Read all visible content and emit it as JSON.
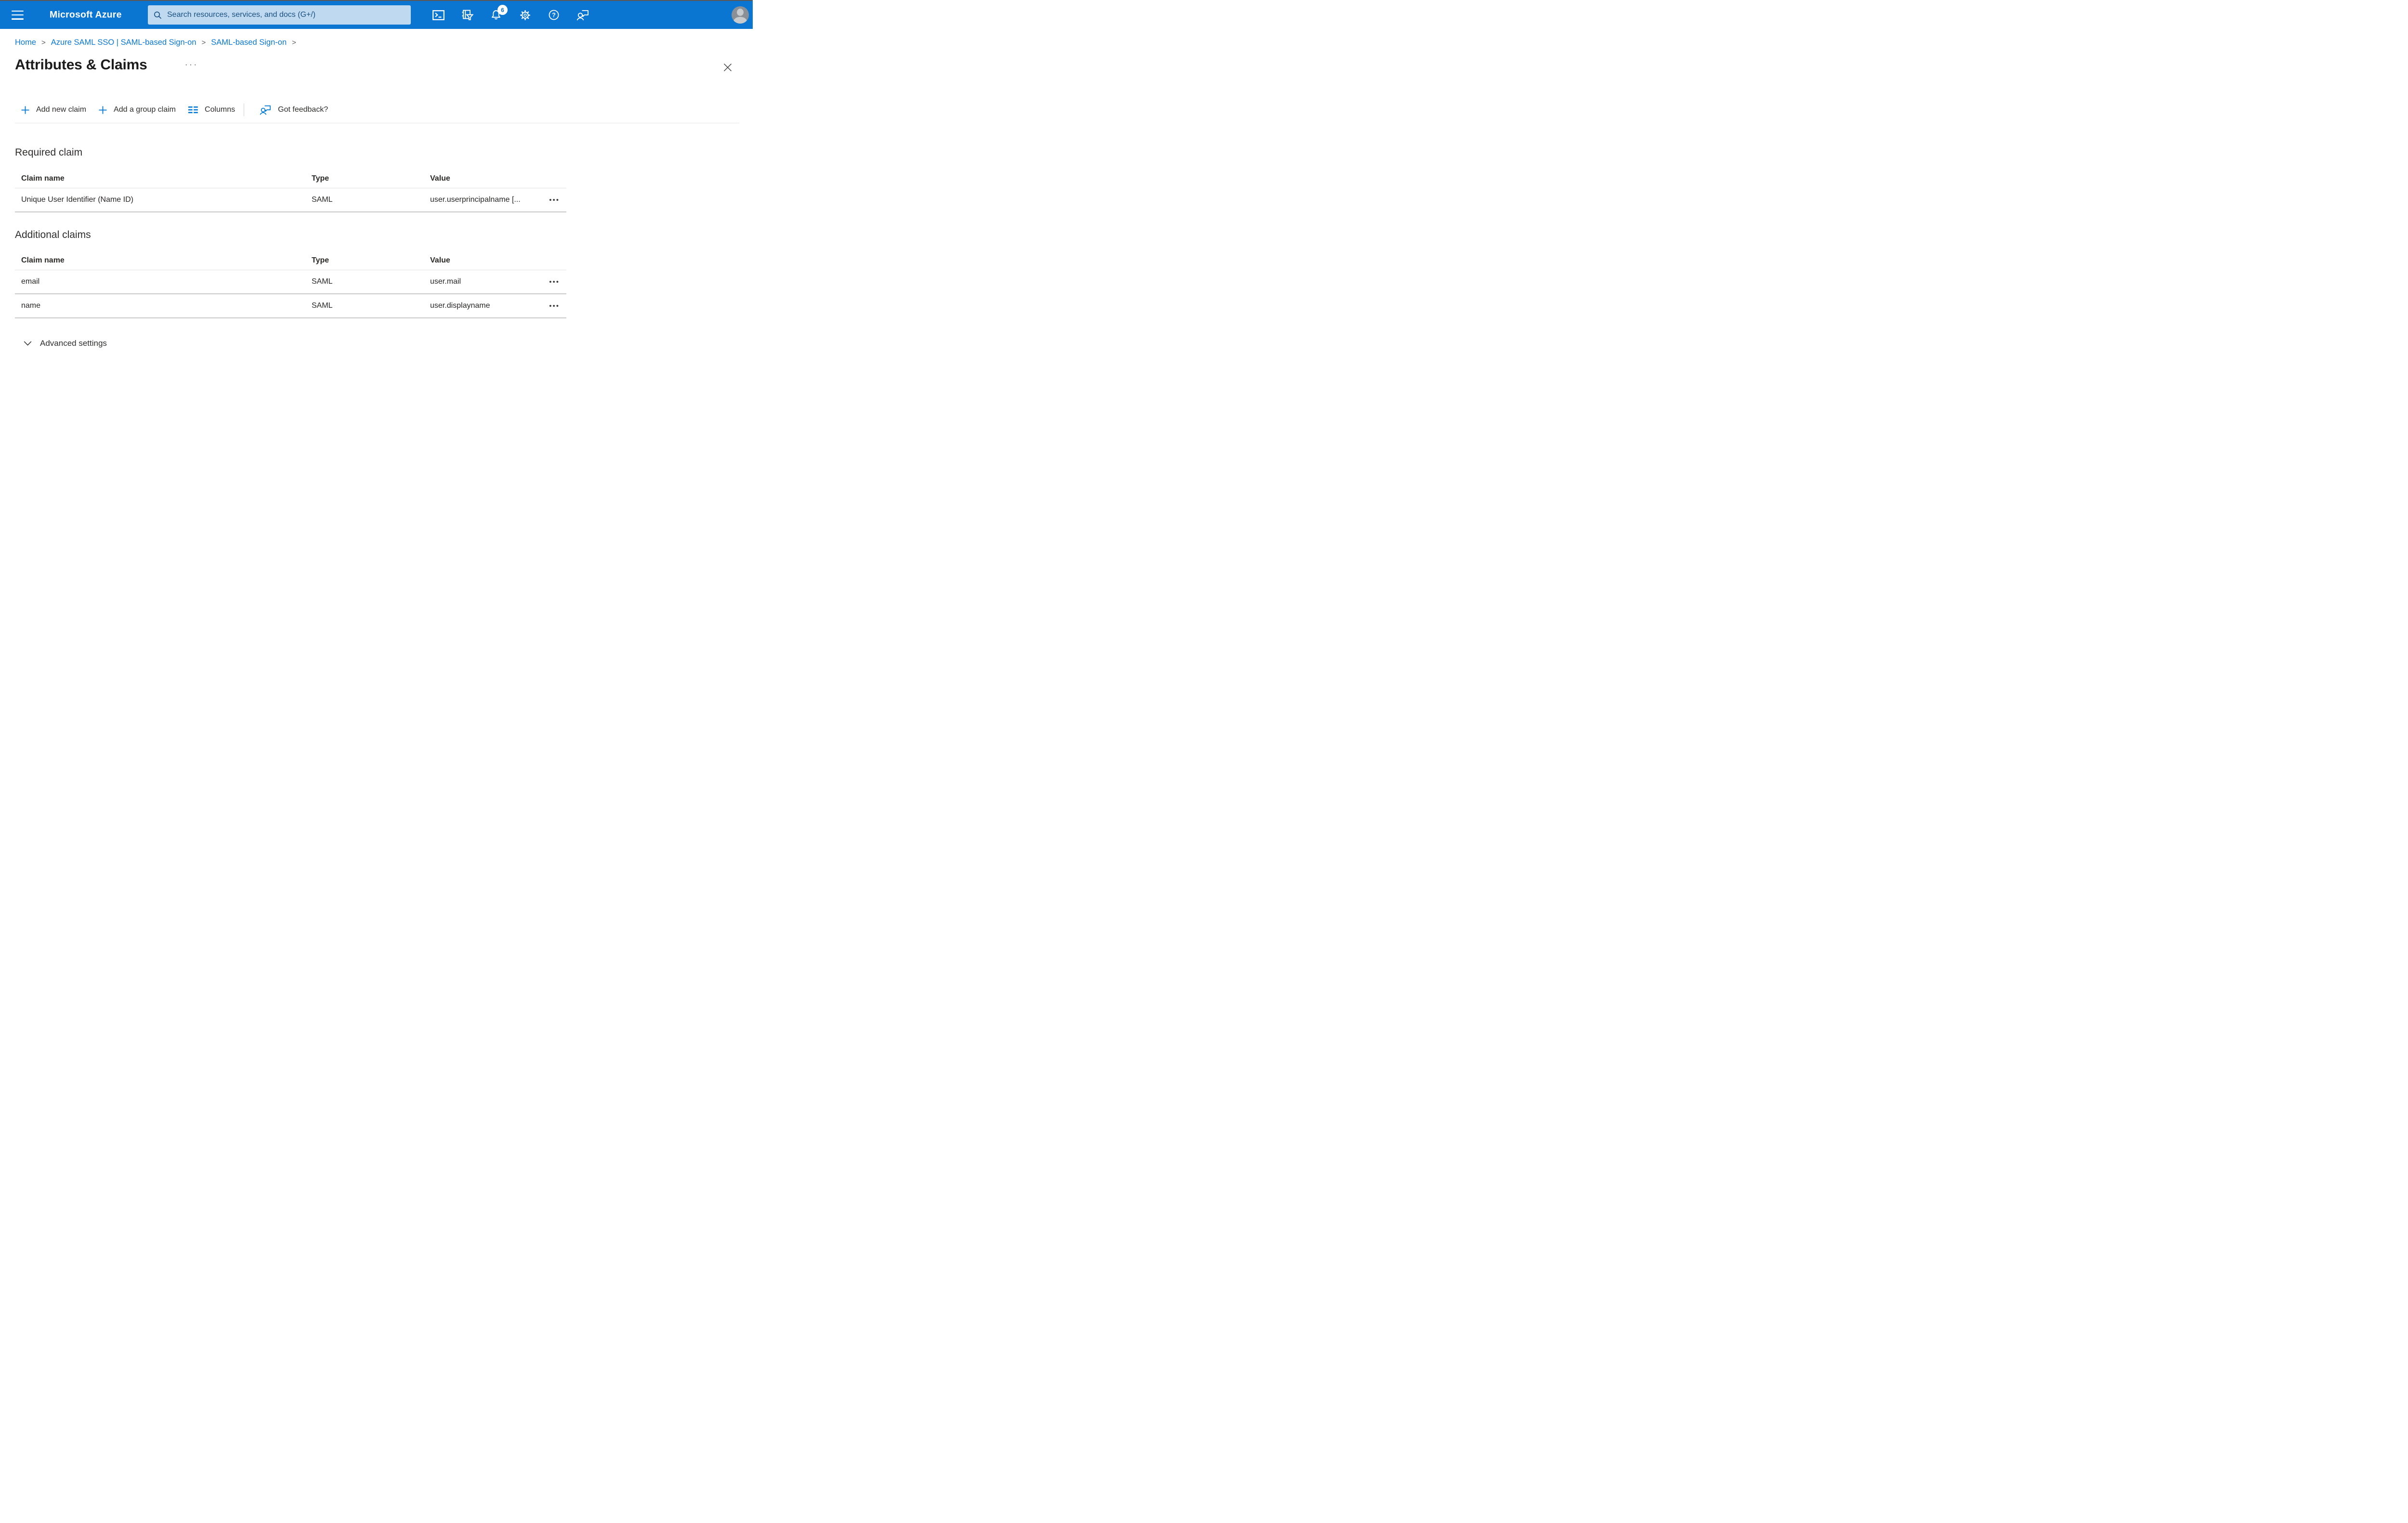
{
  "header": {
    "app_title": "Microsoft Azure",
    "search": {
      "placeholder": "Search resources, services, and docs (G+/)"
    },
    "notifications": {
      "count": "6"
    },
    "colors": {
      "background": "#0b76d2",
      "search_background": "#bfd9f1",
      "search_text": "#1a5180"
    }
  },
  "breadcrumb": {
    "separator": ">",
    "items": [
      "Home",
      "Azure SAML SSO | SAML-based Sign-on",
      "SAML-based Sign-on"
    ]
  },
  "page": {
    "title": "Attributes & Claims",
    "title_menu_glyph": "···"
  },
  "toolbar": {
    "add_new_claim": "Add new claim",
    "add_group_claim": "Add a group claim",
    "columns": "Columns",
    "got_feedback": "Got feedback?"
  },
  "sections": {
    "required": {
      "heading": "Required claim",
      "columns": {
        "claim_name": "Claim name",
        "type": "Type",
        "value": "Value"
      },
      "rows": [
        {
          "claim_name": "Unique User Identifier (Name ID)",
          "type": "SAML",
          "value": "user.userprincipalname [...",
          "menu_glyph": "•••"
        }
      ]
    },
    "additional": {
      "heading": "Additional claims",
      "columns": {
        "claim_name": "Claim name",
        "type": "Type",
        "value": "Value"
      },
      "rows": [
        {
          "claim_name": "email",
          "type": "SAML",
          "value": "user.mail",
          "menu_glyph": "•••"
        },
        {
          "claim_name": "name",
          "type": "SAML",
          "value": "user.displayname",
          "menu_glyph": "•••"
        }
      ]
    }
  },
  "advanced": {
    "label": "Advanced settings"
  },
  "colors": {
    "accent": "#0078d4",
    "link": "#0a78d4",
    "text": "#323130",
    "row_border": "#c9c9c9",
    "header_border": "#e1e1e1"
  }
}
